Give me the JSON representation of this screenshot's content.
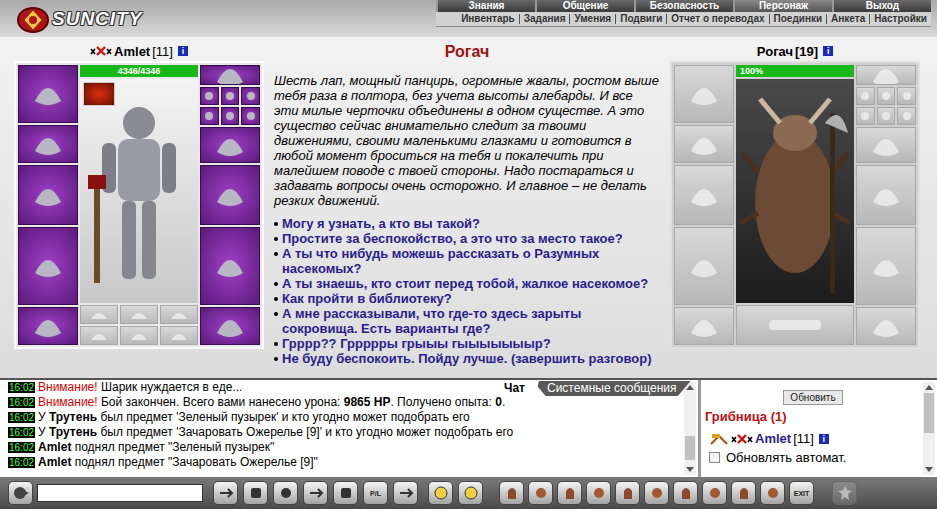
{
  "header": {
    "logo": "SUNCITY",
    "nav": [
      {
        "label": "Знания",
        "selected": false
      },
      {
        "label": "Общение",
        "selected": false
      },
      {
        "label": "Безопасность",
        "selected": false
      },
      {
        "label": "Персонаж",
        "selected": true
      },
      {
        "label": "Выход",
        "selected": false
      }
    ],
    "subnav": [
      "Инвентарь",
      "Задания",
      "Умения",
      "Подвиги",
      "Отчет о переводах",
      "Поединки",
      "Анкета",
      "Настройки"
    ]
  },
  "player": {
    "name": "Amlet",
    "level": "[11]",
    "info": "i",
    "hp": "4346/4346",
    "hp_level": 1,
    "left_slots": [
      {
        "filled": true
      },
      {
        "filled": true
      },
      {
        "filled": true
      },
      {
        "filled": true
      },
      {
        "filled": true
      }
    ],
    "right_slots": [
      {
        "kind": "single",
        "filled": true
      },
      {
        "kind": "triple",
        "filled": true
      },
      {
        "kind": "triple",
        "filled": true
      },
      {
        "kind": "single",
        "filled": true
      },
      {
        "kind": "single",
        "filled": true
      },
      {
        "kind": "single",
        "filled": true
      },
      {
        "kind": "single",
        "filled": true
      }
    ],
    "bottom_slots": [
      {
        "filled": false
      },
      {
        "filled": false
      },
      {
        "filled": false
      },
      {
        "filled": false
      },
      {
        "filled": false
      },
      {
        "filled": false
      }
    ]
  },
  "dialog": {
    "title": "Рогач",
    "description": "Шесть лап, мощный панцирь, огромные жвалы, ростом выше тебя раза в полтора, без учета высоты алебарды. И все эти милые черточки объединены в одном существе. А это существо сейчас внимательно следит за твоими движениями, своими маленькими глазками и готовится в любой момент броситься на тебя и покалечить при малейшем поводе с твоей стороны. Надо постараться и задавать вопросы очень осторожно. И главное – не делать резких движений.",
    "options": [
      "Могу я узнать, а кто вы такой?",
      "Простите за беспокойство, а это что за место такое?",
      "А ты что нибудь можешь рассказать о Разумных насекомых?",
      "А ты знаешь, кто стоит перед тобой, жалкое насекомое?",
      "Как пройти в библиотеку?",
      "А мне рассказывали, что где-то здесь зарыты сокровища. Есть варианты где?",
      "Грррр?? Гррррры грыыы гыыыыыыыр?",
      "Не буду беспокоить. Пойду лучше. (завершить разговор)"
    ]
  },
  "monster": {
    "name": "Рогач",
    "level": "[19]",
    "info": "i",
    "hp": "100%",
    "hp_level": 1,
    "left_slots": [
      {
        "filled": false
      },
      {
        "filled": false
      },
      {
        "filled": false
      },
      {
        "filled": false
      },
      {
        "filled": false
      }
    ],
    "right_slots": [
      {
        "kind": "single",
        "filled": false
      },
      {
        "kind": "triple",
        "filled": false
      },
      {
        "kind": "triple",
        "filled": false
      },
      {
        "kind": "single",
        "filled": false
      },
      {
        "kind": "single",
        "filled": false
      },
      {
        "kind": "single",
        "filled": false
      },
      {
        "kind": "single",
        "filled": false
      }
    ],
    "bottom_slots": [
      {
        "filled": false
      }
    ]
  },
  "chat": {
    "tabs": [
      {
        "label": "Чат",
        "selected": true
      },
      {
        "label": "Системные сообщения",
        "selected": false
      }
    ],
    "messages": [
      {
        "time": "16:02",
        "parts": [
          {
            "text": "Внимание!",
            "kind": "alert"
          },
          {
            "text": " Шарик нуждается в еде...",
            "kind": "plain"
          }
        ]
      },
      {
        "time": "16:02",
        "parts": [
          {
            "text": "Внимание!",
            "kind": "alert"
          },
          {
            "text": " Бой закончен. Всего вами нанесено урона: ",
            "kind": "plain"
          },
          {
            "text": "9865 HP",
            "kind": "bold"
          },
          {
            "text": ". Получено опыта: ",
            "kind": "plain"
          },
          {
            "text": "0",
            "kind": "bold"
          },
          {
            "text": ".",
            "kind": "plain"
          }
        ]
      },
      {
        "time": "16:02",
        "parts": [
          {
            "text": "У ",
            "kind": "plain"
          },
          {
            "text": "Трутень",
            "kind": "bold"
          },
          {
            "text": " был предмет 'Зеленый пузырек' и кто угодно может подобрать его",
            "kind": "plain"
          }
        ]
      },
      {
        "time": "16:02",
        "parts": [
          {
            "text": "У ",
            "kind": "plain"
          },
          {
            "text": "Трутень",
            "kind": "bold"
          },
          {
            "text": " был предмет 'Зачаровать Ожерелье [9]' и кто угодно может подобрать его",
            "kind": "plain"
          }
        ]
      },
      {
        "time": "16:02",
        "parts": [
          {
            "text": "Amlet",
            "kind": "bold"
          },
          {
            "text": " поднял предмет \"Зеленый пузырек\"",
            "kind": "plain"
          }
        ]
      },
      {
        "time": "16:02",
        "parts": [
          {
            "text": "Amlet",
            "kind": "bold"
          },
          {
            "text": " поднял предмет \"Зачаровать Ожерелье [9]\"",
            "kind": "plain"
          }
        ]
      }
    ],
    "refresh_button": "Обновить",
    "location": "Грибница (1)",
    "users": [
      {
        "name": "Amlet",
        "level": "[11]",
        "info": "i"
      }
    ],
    "auto_refresh": {
      "label": "Обновлять автомат.",
      "checked": false
    }
  },
  "toolbar": {
    "input_value": "",
    "left_buttons": [
      {
        "label": "",
        "disabled": false
      },
      {
        "label": "",
        "disabled": false
      },
      {
        "label": "",
        "disabled": false
      },
      {
        "label": "",
        "disabled": false
      },
      {
        "label": "",
        "disabled": false
      },
      {
        "label": "P/L",
        "disabled": false
      },
      {
        "label": "",
        "disabled": false
      }
    ],
    "mid_buttons": [
      {
        "label": "",
        "disabled": false
      },
      {
        "label": "",
        "disabled": false
      }
    ],
    "right_buttons": [
      {
        "label": "",
        "disabled": false
      },
      {
        "label": "",
        "disabled": false
      },
      {
        "label": "",
        "disabled": false
      },
      {
        "label": "",
        "disabled": false
      },
      {
        "label": "",
        "disabled": false
      },
      {
        "label": "",
        "disabled": false
      },
      {
        "label": "",
        "disabled": false
      },
      {
        "label": "",
        "disabled": false
      },
      {
        "label": "",
        "disabled": false
      },
      {
        "label": "",
        "disabled": false
      },
      {
        "label": "EXIT",
        "disabled": false
      },
      {
        "label": "",
        "disabled": true
      }
    ]
  }
}
